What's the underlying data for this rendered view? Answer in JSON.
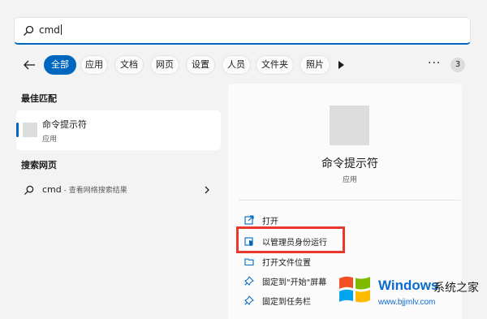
{
  "search": {
    "value": "cmd",
    "icon": "search-icon"
  },
  "filters": {
    "back_icon": "arrow-left-icon",
    "chips": [
      {
        "label": "全部",
        "active": true
      },
      {
        "label": "应用",
        "active": false
      },
      {
        "label": "文档",
        "active": false
      },
      {
        "label": "网页",
        "active": false
      },
      {
        "label": "设置",
        "active": false
      },
      {
        "label": "人员",
        "active": false
      },
      {
        "label": "文件夹",
        "active": false
      },
      {
        "label": "照片",
        "active": false
      }
    ],
    "more_label": "···",
    "badge": "3"
  },
  "best_match": {
    "heading": "最佳匹配",
    "name": "命令提示符",
    "type": "应用"
  },
  "web_search": {
    "heading": "搜索网页",
    "query": "cmd",
    "hint": " - 查看网络搜索结果"
  },
  "detail": {
    "name": "命令提示符",
    "type": "应用",
    "actions": [
      {
        "label": "打开",
        "icon": "open-external-icon"
      },
      {
        "label": "以管理员身份运行",
        "icon": "shield-icon"
      },
      {
        "label": "打开文件位置",
        "icon": "folder-icon"
      },
      {
        "label": "固定到\"开始\"屏幕",
        "icon": "pin-icon"
      },
      {
        "label": "固定到任务栏",
        "icon": "pin-icon"
      }
    ]
  },
  "watermark": {
    "title": "Windows",
    "subtitle": "系统之家",
    "url": "www.bjjmlv.com"
  },
  "colors": {
    "accent": "#0067c0",
    "highlight": "#e8392c",
    "background": "#f3f3f3"
  }
}
